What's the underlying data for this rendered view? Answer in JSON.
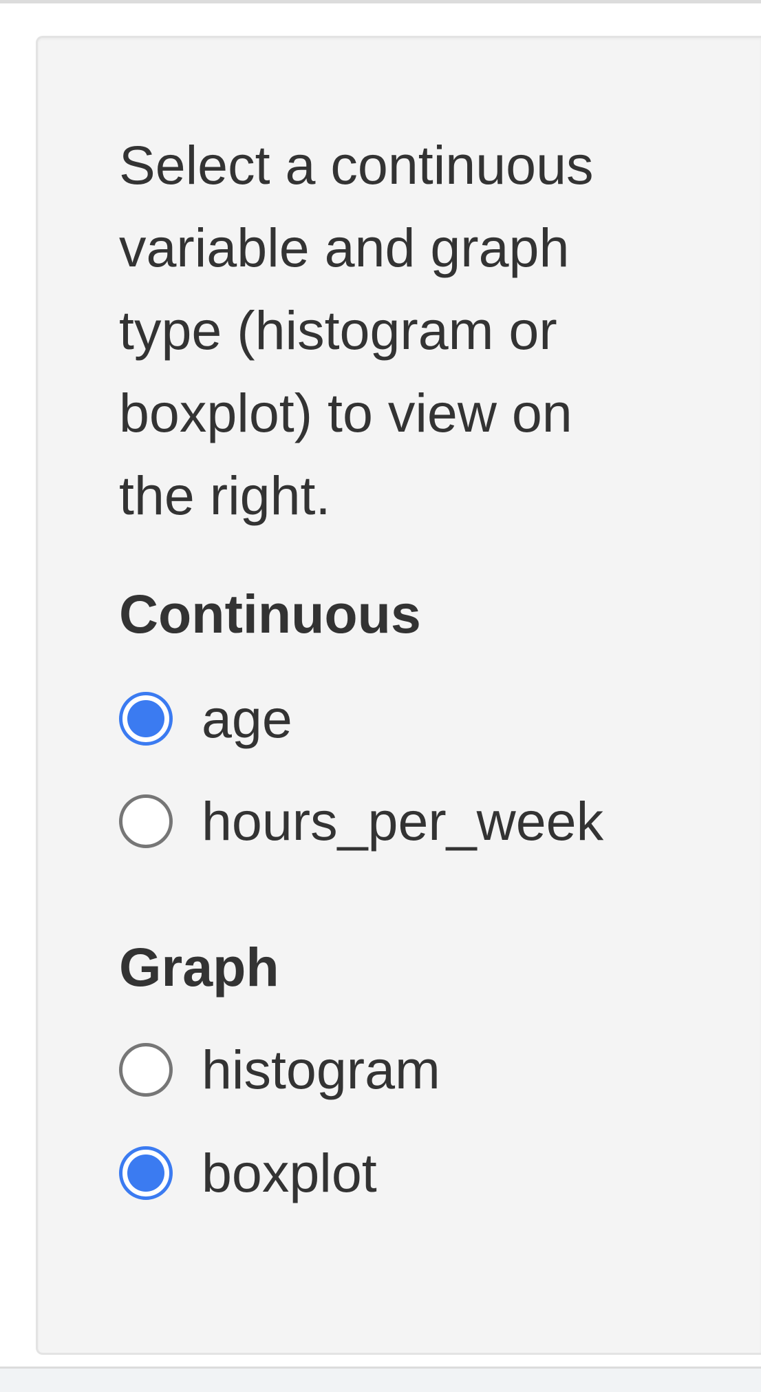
{
  "help_text": "Select a continuous variable and graph type (histogram or boxplot) to view on the right.",
  "continuous": {
    "label": "Continuous",
    "options": [
      {
        "label": "age",
        "selected": true
      },
      {
        "label": "hours_per_week",
        "selected": false
      }
    ]
  },
  "graph": {
    "label": "Graph",
    "options": [
      {
        "label": "histogram",
        "selected": false
      },
      {
        "label": "boxplot",
        "selected": true
      }
    ]
  },
  "colors": {
    "accent": "#3b7bf1",
    "panel_background": "#f4f4f4",
    "text": "#333333"
  }
}
